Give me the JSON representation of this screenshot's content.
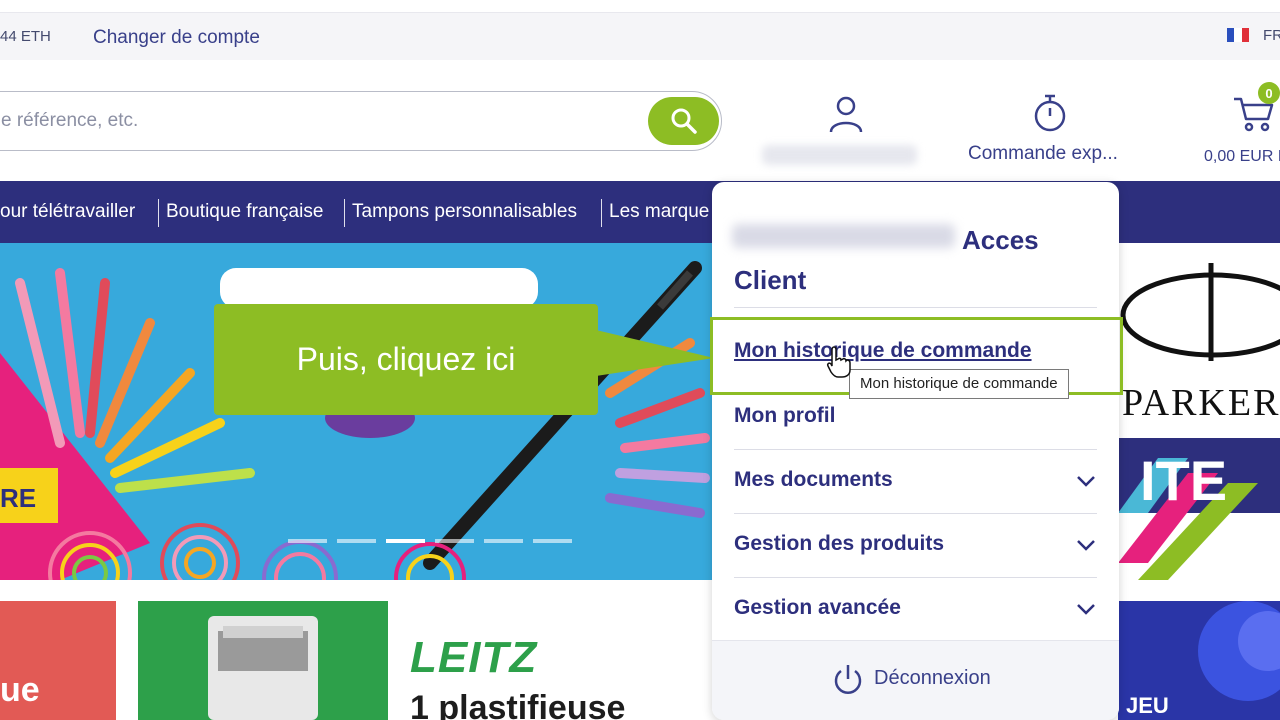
{
  "topbar": {
    "eth": "44 ETH",
    "switch_account": "Changer de compte",
    "lang": "FR"
  },
  "search": {
    "placeholder": "e référence, etc."
  },
  "header": {
    "express_order": "Commande exp...",
    "cart_count": "0",
    "cart_total": "0,00 EUR H"
  },
  "nav": {
    "items": [
      "our télétravailler",
      "Boutique française",
      "Tampons personnalisables",
      "Les marque"
    ]
  },
  "banner": {
    "left_tag": "RE"
  },
  "callout": {
    "text": "Puis, cliquez ici"
  },
  "dropdown": {
    "title_part1": "Acces",
    "title_part2": "Client",
    "items": [
      {
        "label": "Mon historique de commande"
      },
      {
        "label": "Mon profil"
      },
      {
        "label": "Mes documents"
      },
      {
        "label": "Gestion des produits"
      },
      {
        "label": "Gestion avancée"
      }
    ],
    "logout": "Déconnexion"
  },
  "tooltip": {
    "text": "Mon historique de commande"
  },
  "promo": {
    "red_text": "ue",
    "leitz_brand": "LEITZ",
    "leitz_sub": "1 plastifieuse",
    "blue_text": "JEU",
    "parker_text": "PARKER"
  },
  "colors": {
    "brand_navy": "#2d2f7d",
    "accent_green": "#8dbd24",
    "banner_blue": "#37a9dc"
  }
}
